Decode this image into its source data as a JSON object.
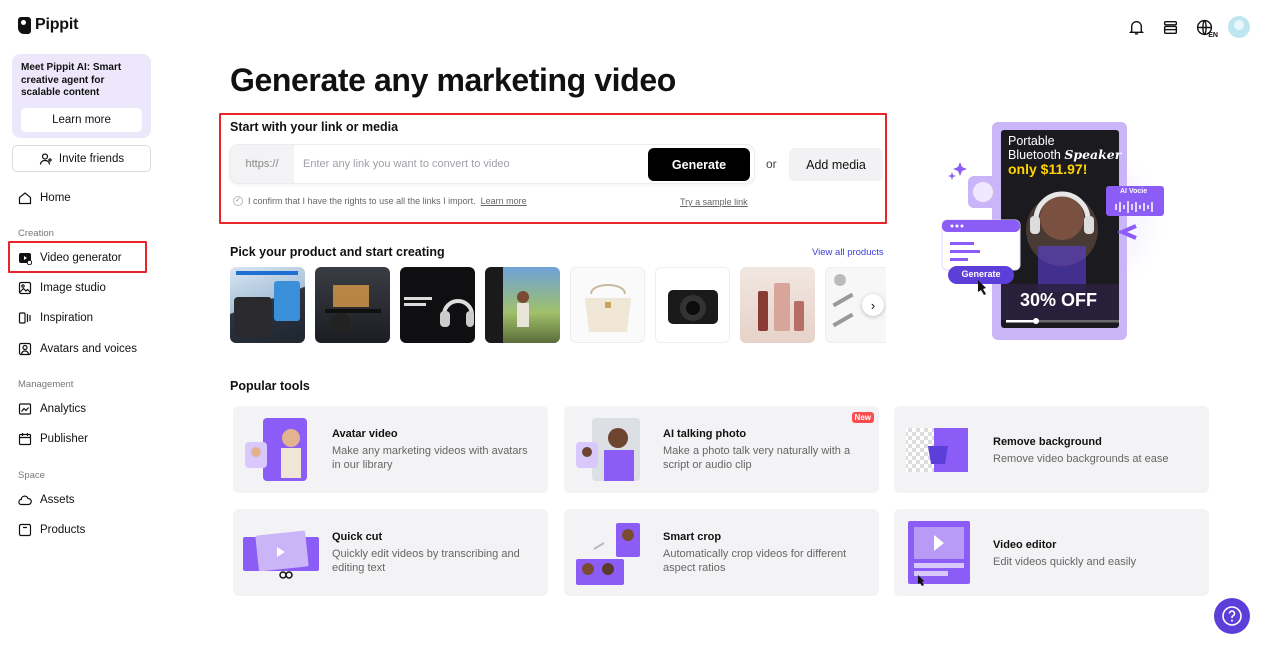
{
  "app": {
    "name": "Pippit"
  },
  "promo": {
    "text": "Meet Pippit AI: Smart creative agent for scalable content",
    "button_label": "Learn more"
  },
  "invite": {
    "label": "Invite friends"
  },
  "nav": {
    "home": "Home",
    "section_creation": "Creation",
    "video_generator": "Video generator",
    "image_studio": "Image studio",
    "inspiration": "Inspiration",
    "avatars_voices": "Avatars and voices",
    "section_management": "Management",
    "analytics": "Analytics",
    "publisher": "Publisher",
    "section_space": "Space",
    "assets": "Assets",
    "products": "Products"
  },
  "topbar": {
    "language": "EN"
  },
  "main": {
    "headline": "Generate any marketing video",
    "link_section": {
      "title": "Start with your link or media",
      "prefix": "https://",
      "placeholder": "Enter any link you want to convert to video",
      "generate_label": "Generate",
      "or_label": "or",
      "add_media_label": "Add media",
      "confirm_text": "I confirm that I have the rights to use all the links I import.",
      "confirm_link": "Learn more",
      "sample_link": "Try a sample link"
    },
    "pick": {
      "title": "Pick your product and start creating",
      "view_all": "View all products"
    },
    "popular": {
      "title": "Popular tools",
      "tools": [
        {
          "title": "Avatar video",
          "desc": "Make any marketing videos with avatars in our library"
        },
        {
          "title": "AI talking photo",
          "desc": "Make a photo talk very naturally with a script or audio clip",
          "badge": "New"
        },
        {
          "title": "Remove background",
          "desc": "Remove video backgrounds at ease"
        },
        {
          "title": "Quick cut",
          "desc": "Quickly edit videos by transcribing and editing text"
        },
        {
          "title": "Smart crop",
          "desc": "Automatically crop videos for different aspect ratios"
        },
        {
          "title": "Video editor",
          "desc": "Edit videos quickly and easily"
        }
      ]
    }
  },
  "hero": {
    "line1": "Portable",
    "line2": "Bluetooth",
    "line2_script": "Speaker",
    "price": "only $11.97!",
    "voice_label": "AI Vocie",
    "generate_label": "Generate",
    "discount": "30% OFF"
  },
  "colors": {
    "accent": "#8b5cf6",
    "highlight_box": "#e8262a",
    "help_button": "#5b3fd8"
  }
}
